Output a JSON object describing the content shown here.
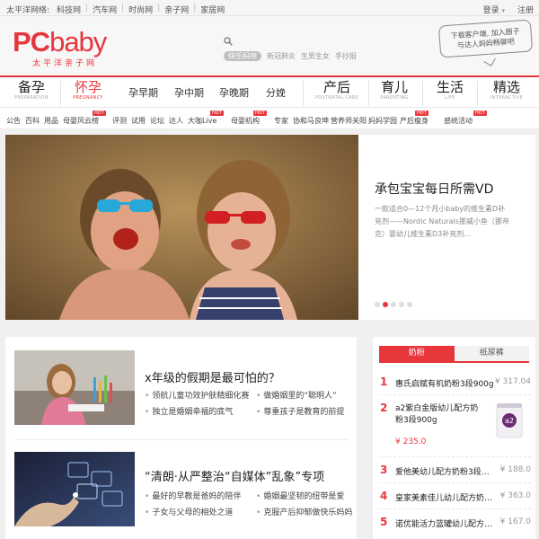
{
  "netbar": {
    "label": "太平洋网络:",
    "links": [
      "科技网",
      "汽车网",
      "时尚网",
      "亲子网",
      "家居网"
    ],
    "login": "登录",
    "register": "注册"
  },
  "logo": {
    "brand_pc": "PC",
    "brand_rest": "baby",
    "sub": "太平洋亲子网"
  },
  "search": {
    "placeholder": "",
    "hot_words": [
      "快乐妈咪",
      "新冠肺炎",
      "生男生女",
      "手抄报"
    ]
  },
  "bubble": {
    "line1": "下载客户端, 加入圈子",
    "line2": "与达人妈妈畅聊吧"
  },
  "channel": {
    "groups": [
      {
        "main": "备孕",
        "en": "PREPARATION"
      },
      {
        "main": "怀孕",
        "en": "PREGNANCY"
      },
      {
        "main": "产后",
        "en": "POSTNATAL CARE"
      },
      {
        "main": "育儿",
        "en": "PARENTING"
      },
      {
        "main": "生活",
        "en": "LIFE"
      },
      {
        "main": "精选",
        "en": "INTERACTIVE"
      }
    ],
    "sub": [
      "孕早期",
      "孕中期",
      "孕晚期",
      "分娩"
    ]
  },
  "tags": [
    "公告",
    "百科",
    "用品",
    "母婴风云榜",
    "评测",
    "试用",
    "论坛",
    "达人",
    "大咖Live",
    "母婴机构",
    "专家",
    "协和马良坤",
    "营养师关阳",
    "妈妈学园",
    "产后瘦身",
    "感统活动"
  ],
  "hot_label": "HOT",
  "hero": {
    "title": "承包宝宝每日所需VD",
    "desc": "一款适合0—12个月小baby的维生素D补充剂——Nordic Naturals挪威小鱼（挪帝克）婴幼儿维生素D3补充剂..."
  },
  "articles": [
    {
      "title": "x年级的假期是最可怕的？",
      "links": [
        "领航儿童功效护肤精细化赛",
        "做婚姻里的“聪明人”",
        "独立是婚姻幸福的底气",
        "尊重孩子是教育的前提"
      ]
    },
    {
      "title": "“清朗·从严整治“自媒体”乱象”专项",
      "links": [
        "最好的早教是爸妈的陪伴",
        "婚姻最坚韧的纽带是爱",
        "子女与父母的相处之道",
        "克服产后抑郁做快乐妈妈"
      ]
    }
  ],
  "ranking": {
    "tabs": [
      "奶粉",
      "纸尿裤"
    ],
    "items": [
      {
        "no": "1",
        "name": "惠氏启赋有机奶粉3段900g",
        "price": "¥ 317.04"
      },
      {
        "no": "2",
        "name": "a2紫白金版幼儿配方奶粉3段900g",
        "price": "¥ 235.0"
      },
      {
        "no": "3",
        "name": "爱他美幼儿配方奶粉3段900g",
        "price": "¥ 188.0"
      },
      {
        "no": "4",
        "name": "皇家美素佳儿幼儿配方奶粉3...",
        "price": "¥ 363.0"
      },
      {
        "no": "5",
        "name": "诺优能活力蓝罐幼儿配方奶...",
        "price": "¥ 167.0"
      }
    ]
  },
  "colors": {
    "brand": "#e8363d",
    "bg": "#f0f0f0"
  }
}
